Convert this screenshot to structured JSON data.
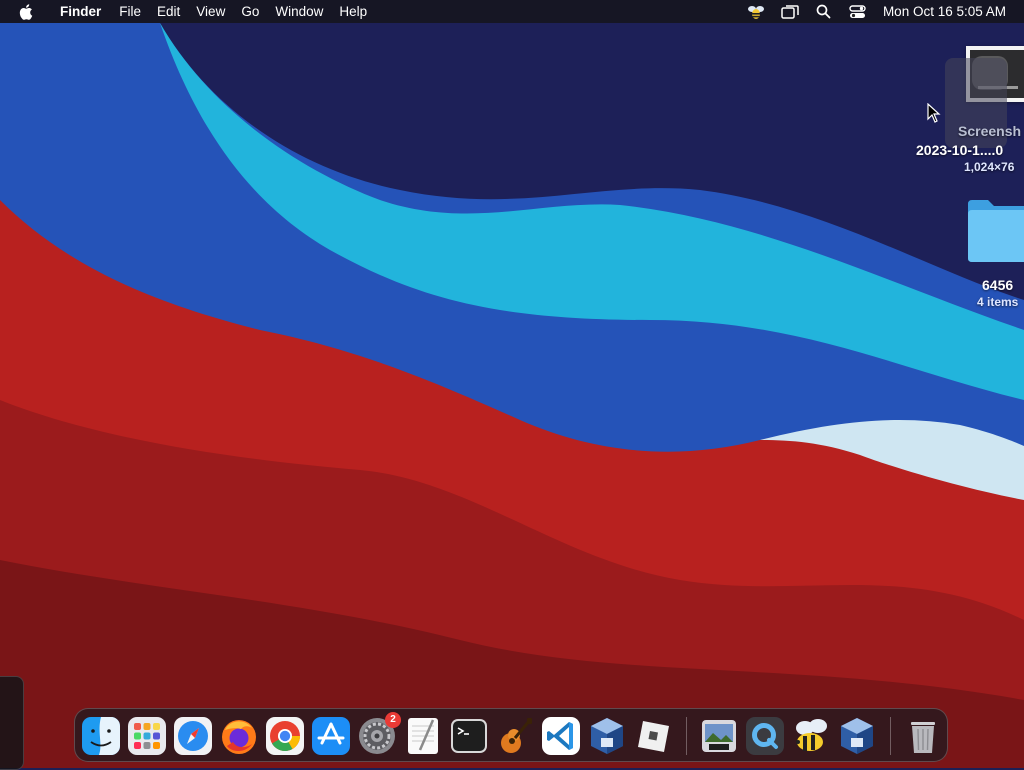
{
  "menubar": {
    "apple_icon": "apple-logo-icon",
    "app_name": "Finder",
    "menus": [
      "File",
      "Edit",
      "View",
      "Go",
      "Window",
      "Help"
    ],
    "status_icons": [
      "bee-icon",
      "screen-mirroring-icon",
      "spotlight-search-icon",
      "control-center-icon"
    ],
    "clock": "Mon Oct 16  5:05 AM"
  },
  "desktop": {
    "icons": [
      {
        "name": "Screensh",
        "name_line2": "2023-10-1....0",
        "meta": "1,024×76",
        "kind": "screenshot-file"
      },
      {
        "name": "6456",
        "meta": "4 items",
        "kind": "folder"
      }
    ]
  },
  "dock": {
    "apps": [
      {
        "name": "Finder",
        "icon": "finder-icon"
      },
      {
        "name": "Launchpad",
        "icon": "launchpad-icon"
      },
      {
        "name": "Safari",
        "icon": "safari-icon"
      },
      {
        "name": "Firefox",
        "icon": "firefox-icon"
      },
      {
        "name": "Google Chrome",
        "icon": "chrome-icon"
      },
      {
        "name": "App Store",
        "icon": "app-store-icon"
      },
      {
        "name": "System Settings",
        "icon": "system-settings-icon",
        "badge": "2"
      },
      {
        "name": "TextEdit",
        "icon": "textedit-icon"
      },
      {
        "name": "Terminal",
        "icon": "terminal-icon"
      },
      {
        "name": "GarageBand",
        "icon": "garageband-icon"
      },
      {
        "name": "Visual Studio Code",
        "icon": "vscode-icon"
      },
      {
        "name": "VirtualBox",
        "icon": "virtualbox-icon"
      },
      {
        "name": "Roblox",
        "icon": "roblox-icon"
      },
      {
        "name": "Preview",
        "icon": "preview-icon"
      },
      {
        "name": "QuickTime Player",
        "icon": "quicktime-icon"
      },
      {
        "name": "Bee",
        "icon": "bee-app-icon"
      },
      {
        "name": "VirtualBox VM",
        "icon": "virtualbox-vm-icon"
      },
      {
        "name": "Trash",
        "icon": "trash-icon"
      }
    ]
  },
  "colors": {
    "wallpaper_navy": "#1d2058",
    "wallpaper_blue": "#2553b8",
    "wallpaper_cyan": "#22b4dc",
    "wallpaper_red": "#b8211f",
    "dock_badge": "#ea3a35"
  }
}
